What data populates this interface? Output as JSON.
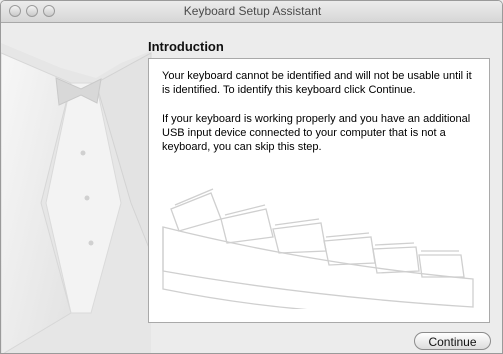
{
  "window": {
    "title": "Keyboard Setup Assistant"
  },
  "main": {
    "heading": "Introduction",
    "paragraph1": "Your keyboard cannot be identified and will not be usable until it is identified. To identify this keyboard click Continue.",
    "paragraph2": "If your keyboard is working properly and you have an additional USB input device connected to your computer that is not a keyboard, you can skip this step."
  },
  "buttons": {
    "continue_label": "Continue"
  },
  "icons": {
    "background": "tuxedo-illustration-icon",
    "keyboard": "keyboard-illustration-icon"
  }
}
